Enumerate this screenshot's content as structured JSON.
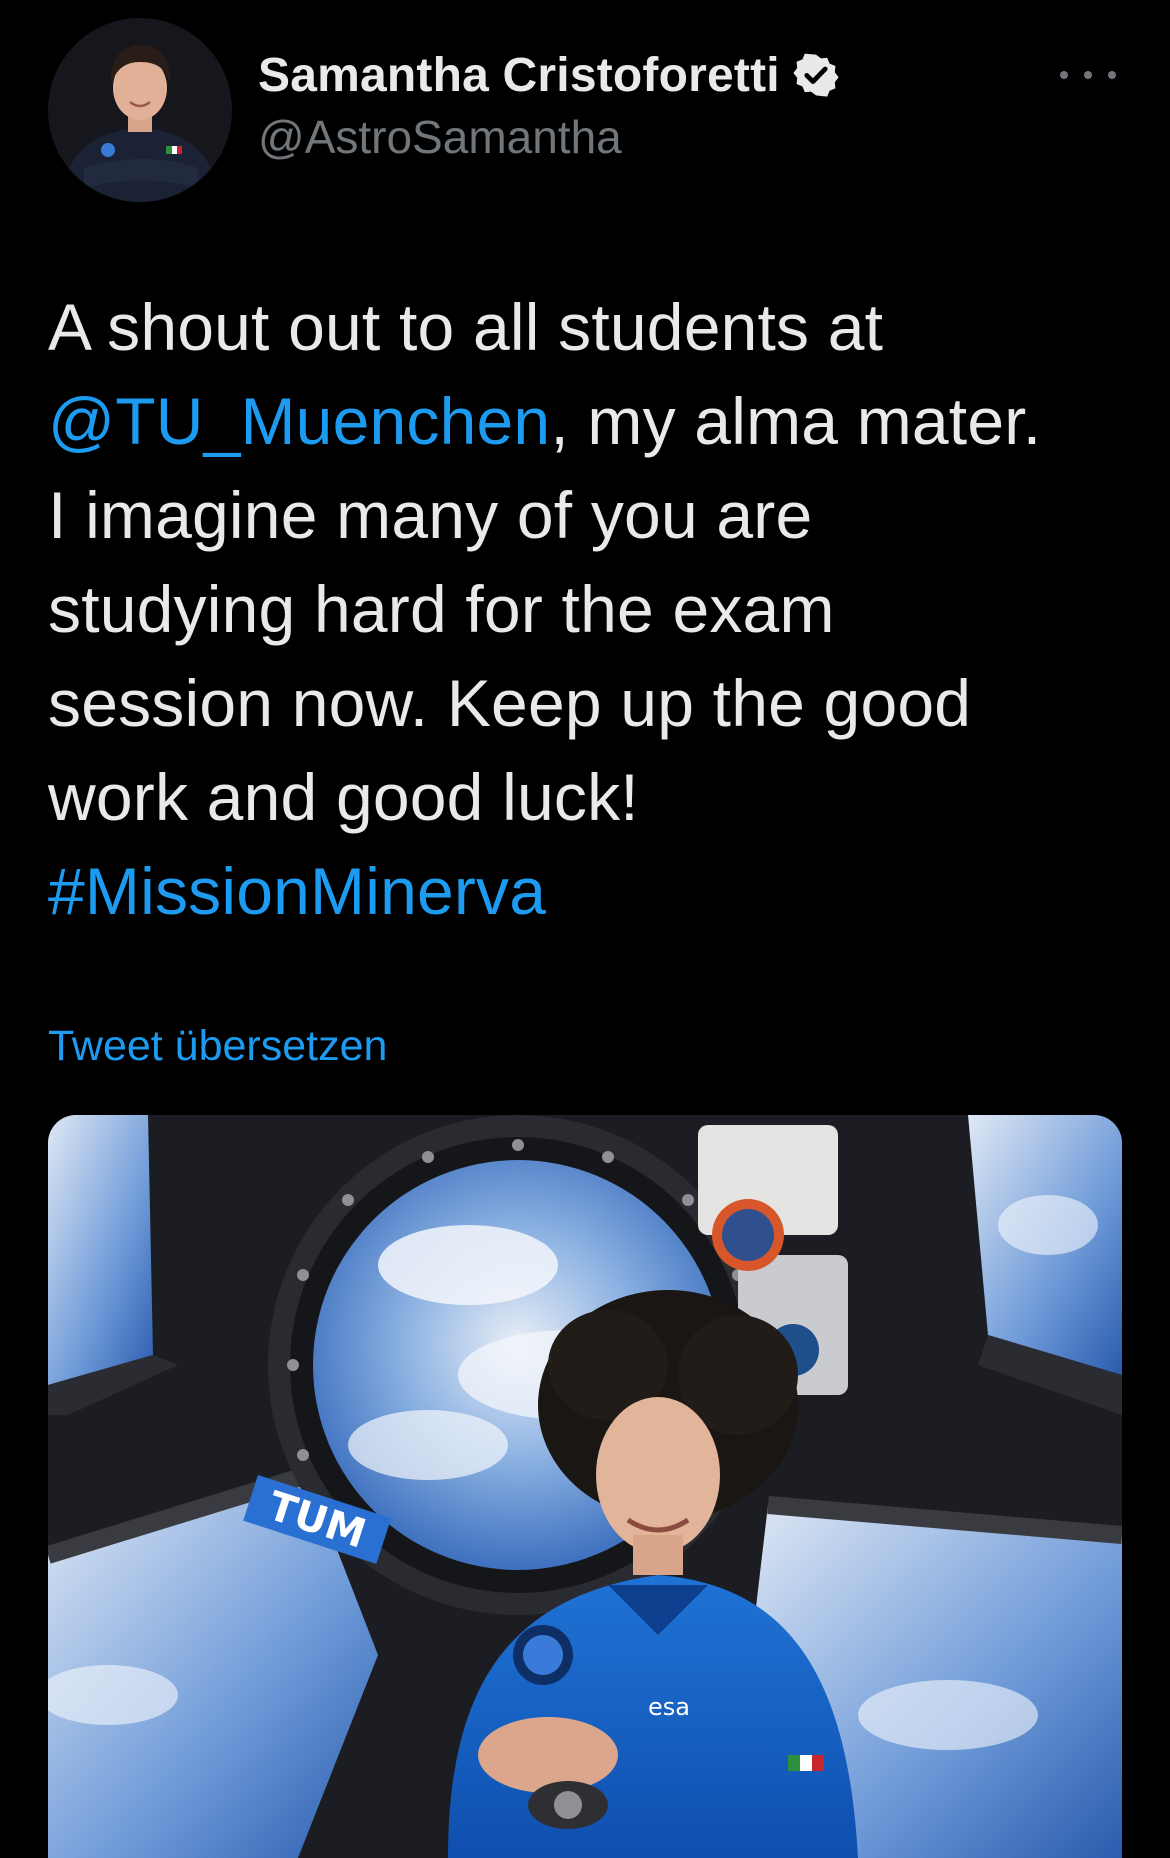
{
  "tweet": {
    "author": {
      "display_name": "Samantha Cristoforetti",
      "handle": "@AstroSamantha",
      "verified": true
    },
    "text_lines": [
      {
        "before": "A shout out to all students at",
        "link": "",
        "after": ""
      },
      {
        "before": "",
        "link": "@TU_Muenchen",
        "after": ", my alma mater."
      },
      {
        "before": "I imagine many of you are",
        "link": "",
        "after": ""
      },
      {
        "before": "studying hard for the exam",
        "link": "",
        "after": ""
      },
      {
        "before": "session now. Keep up the good",
        "link": "",
        "after": ""
      },
      {
        "before": "work and good luck!",
        "link": "",
        "after": ""
      },
      {
        "before": "",
        "link": "#MissionMinerva",
        "after": ""
      }
    ],
    "translate_label": "Tweet übersetzen",
    "media": {
      "tum_logo_text": "TUM",
      "shirt_logo_text": "esa"
    }
  },
  "icons": {
    "verified": "verified-badge-icon",
    "more": "more-horizontal-icon"
  },
  "colors": {
    "background": "#000000",
    "text_primary": "#e7e9ea",
    "text_secondary": "#71767b",
    "link": "#1d9bf0"
  }
}
